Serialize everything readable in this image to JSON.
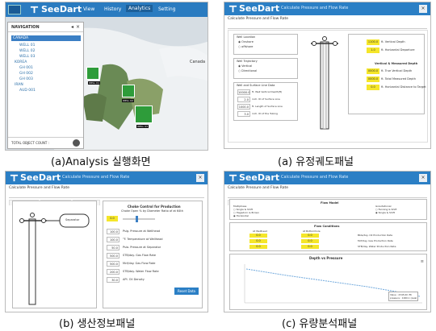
{
  "panel_a": {
    "brand": "SeeDart",
    "menus": [
      "View",
      "History",
      "Analytics",
      "Setting"
    ],
    "dropdown": {
      "header": "ANALYSIS",
      "items": [
        "Calculate Pressure and Flow Rate",
        "Calculate Choke Size"
      ]
    },
    "nav": {
      "title": "NAVIGATION",
      "tree": [
        "CANADA",
        "WELL 01",
        "WELL 02",
        "WELL 03",
        "KOREA",
        "GH 001",
        "GH 002",
        "GH 003",
        "IRAN",
        "AUD 001"
      ],
      "footer": "TOTAL OBJECT COUNT :"
    },
    "map_label": "Canada",
    "markers": [
      "WELL 01",
      "WELL 02",
      "WELL 03"
    ]
  },
  "panel_b": {
    "brand": "SeeDart",
    "title": "Calculate Pressure and Flow Rate",
    "subtitle": "Calculate Pressure and Flow Rate",
    "tabs": [
      "Geometry Data",
      "Production Data",
      "Flow Analysis"
    ],
    "well_location": {
      "title": "Well Location",
      "options": [
        "Onshore",
        "offshore"
      ]
    },
    "well_trajectory": {
      "title": "Well Trajectory",
      "options": [
        "Vertical",
        "Directional"
      ]
    },
    "surface": {
      "title": "Well and Surface Line Data",
      "rows": [
        [
          "10000.0",
          "ft. Well Vertical Depth(ft)"
        ],
        [
          "2.0",
          "inch. ID of Surface Line"
        ],
        [
          "1000.0",
          "ft. Length of Surface Line"
        ],
        [
          "3.0",
          "inch. ID of the Tubing"
        ]
      ]
    },
    "right_top": [
      [
        "1100.0",
        "ft. Vertical Depth"
      ],
      [
        "1.0",
        "ft. Horizontal Departure"
      ]
    ],
    "vm": {
      "title": "Vertical & Measured Depth",
      "rows": [
        [
          "0000.0",
          "ft. True Vertical Depth"
        ],
        [
          "0000.0",
          "ft. Total Measured Depth"
        ],
        [
          "0.0",
          "ft. Horizontal Distance to Target"
        ]
      ]
    }
  },
  "panel_c": {
    "brand": "SeeDart",
    "title": "Calculate Pressure and Flow Rate",
    "subtitle": "Calculate Pressure and Flow Rate",
    "tabs": [
      "Geometry Data",
      "Production Data",
      "Flow Analysis"
    ],
    "separator": "Separator",
    "choke": {
      "title": "Choke Control for Production",
      "sub": "Choke Open % by Diameter Ratio of at 64th",
      "value": "0.0"
    },
    "rows": [
      [
        "100.0",
        "Psig. Pressure at Wellhead"
      ],
      [
        "100.0",
        "°F. Temperature at Wellhead"
      ],
      [
        "50.0",
        "Psia. Pressure at Separator"
      ],
      [
        "500.0",
        "STB/day. Gas Flow Rate"
      ],
      [
        "500.0",
        "Mcf/day. Gas Flow Rate"
      ],
      [
        "200.0",
        "STB/day. Water Flow Rate"
      ],
      [
        "30.0",
        "API. Oil Density"
      ]
    ],
    "reset": "Reset Data"
  },
  "panel_d": {
    "brand": "SeeDart",
    "title": "Calculate Pressure and Flow Rate",
    "subtitle": "Calculate Pressure and Flow Rate",
    "tabs": [
      "Geometry Data",
      "Production Data",
      "Flow Analysis"
    ],
    "flow_model": {
      "title": "Flow Model",
      "left": [
        "Multiphase",
        "Single & Shift",
        "Hagedorn & Brown",
        "Horizontal"
      ],
      "right": [
        "Gravitational",
        "Fanning & Shift",
        "Single & Shift"
      ]
    },
    "pc": {
      "title": "Flow Conditions",
      "at_wellhead": "At Wellhead",
      "at_bottom": "At Bottomhole",
      "vals_l": [
        "0.0",
        "0.0",
        "0.0"
      ],
      "vals_r": [
        "0.0",
        "0.0",
        "0.0"
      ],
      "labels": [
        "Bbls/day. Oil Production Rate",
        "Mcf/day. Gas Production Rate",
        "STB/day. Water Production Rate"
      ]
    },
    "chart_title": "Depth vs Pressure",
    "tooltip": [
      "Value : 2345.00 (ft)",
      "pressure : 1000.1 (psia)"
    ]
  },
  "captions": {
    "a": "(a)Analysis 실행화면",
    "b": "(a) 유정궤도패널",
    "c": "(b) 생산정보패널",
    "d": "(c) 유량분석패널"
  }
}
